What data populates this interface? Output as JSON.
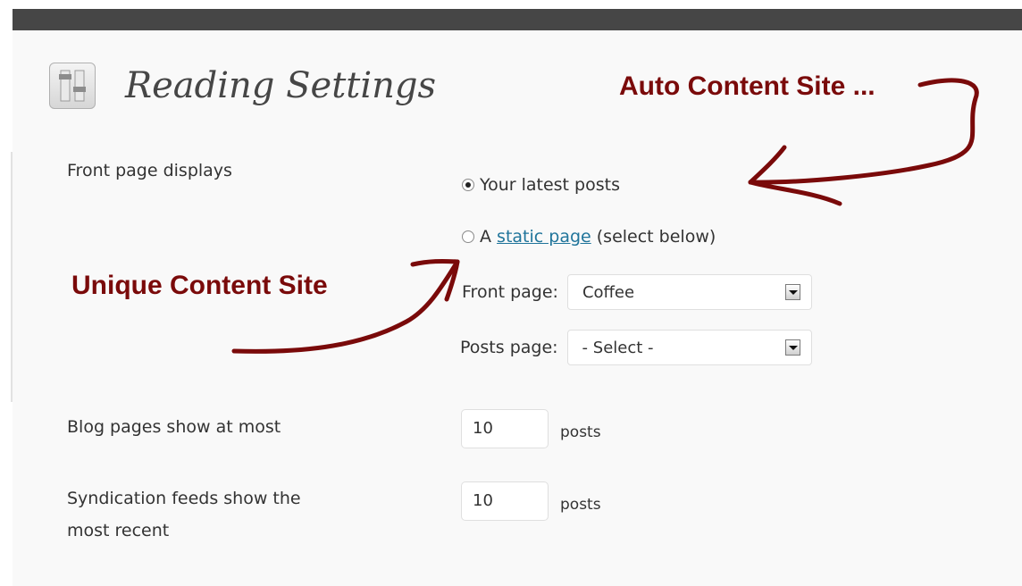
{
  "page": {
    "title": "Reading Settings"
  },
  "front_page_displays": {
    "label": "Front page displays",
    "option_latest": "Your latest posts",
    "option_static_prefix": "A",
    "option_static_link": "static page",
    "option_static_suffix": "(select below)",
    "selected": "latest"
  },
  "front_page_select": {
    "label": "Front page:",
    "value": "Coffee"
  },
  "posts_page_select": {
    "label": "Posts page:",
    "value": "- Select -"
  },
  "blog_pages": {
    "label": "Blog pages show at most",
    "value": "10",
    "suffix": "posts"
  },
  "syndication": {
    "label_line1": "Syndication feeds show the",
    "label_line2": "most recent",
    "value": "10",
    "suffix": "posts"
  },
  "annotations": {
    "auto": "Auto Content Site ...",
    "unique": "Unique Content Site",
    "color": "#7a0a0a"
  },
  "icons": {
    "title": "settings-sliders-icon"
  }
}
